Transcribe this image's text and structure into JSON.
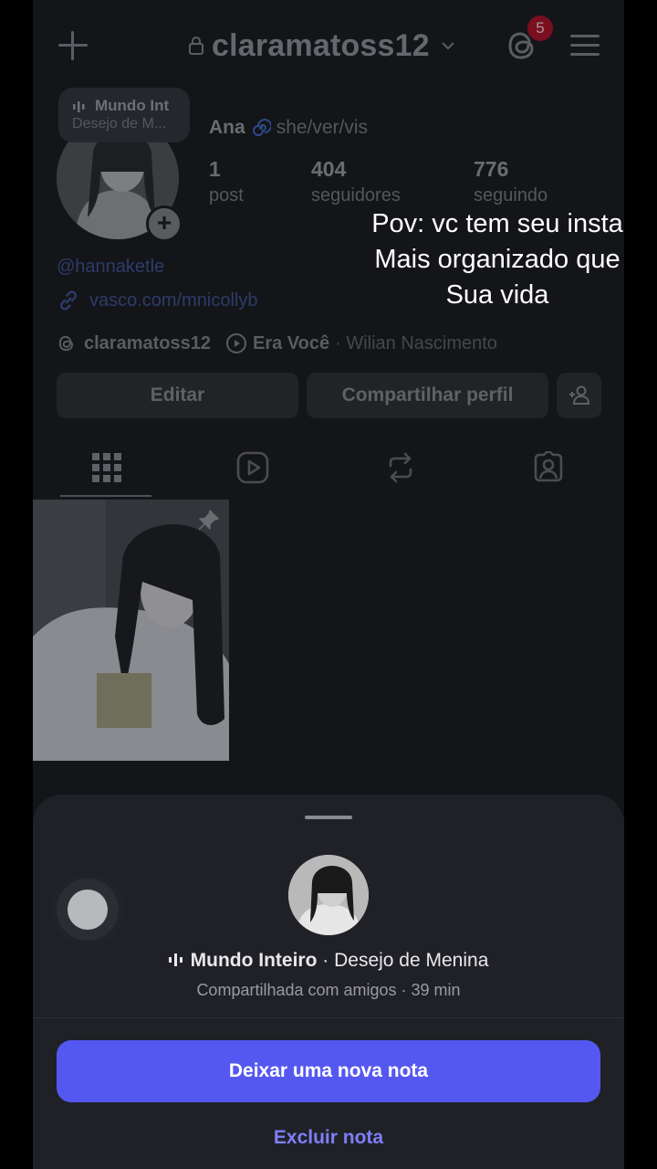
{
  "header": {
    "username": "claramatoss12",
    "notification_count": "5"
  },
  "note": {
    "line1": "Mundo Int",
    "line2": "Desejo de M..."
  },
  "profile": {
    "name": "Ana",
    "pronouns": "she/ver/vis",
    "stats": [
      {
        "value": "1",
        "label": "post"
      },
      {
        "value": "404",
        "label": "seguidores"
      },
      {
        "value": "776",
        "label": "seguindo"
      }
    ],
    "handle": "@hannaketle",
    "link": "vasco.com/mnicollyb",
    "threads_handle": "claramatoss12",
    "music_title": "Era Você",
    "music_artist": "· Wilian Nascimento"
  },
  "buttons": {
    "edit": "Editar",
    "share": "Compartilhar perfil"
  },
  "tabs": [
    "grid-icon",
    "reels-icon",
    "reposts-icon",
    "tagged-icon"
  ],
  "overlay": {
    "line1": "Pov: vc tem seu insta",
    "line2": "Mais organizado que",
    "line3": "Sua vida"
  },
  "sheet": {
    "song_title": "Mundo Inteiro",
    "song_artist": " · Desejo de Menina",
    "subtitle": "Compartilhada com amigos · 39 min",
    "primary_button": "Deixar uma nova nota",
    "secondary_button": "Excluir nota"
  },
  "colors": {
    "accent": "#5558f0",
    "link": "#7d7ff8",
    "badge": "#7a0f1f"
  }
}
